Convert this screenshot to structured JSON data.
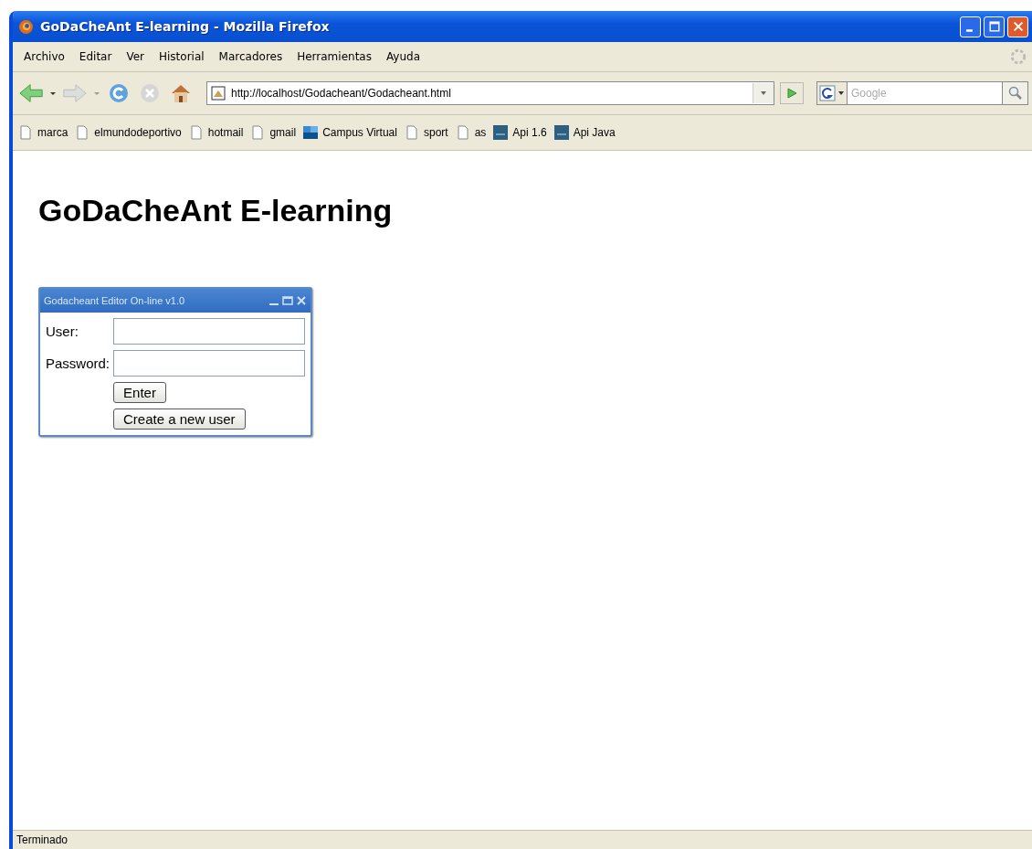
{
  "window": {
    "title": "GoDaCheAnt E-learning - Mozilla Firefox"
  },
  "menu": [
    "Archivo",
    "Editar",
    "Ver",
    "Historial",
    "Marcadores",
    "Herramientas",
    "Ayuda"
  ],
  "address": {
    "value": "http://localhost/Godacheant/Godacheant.html"
  },
  "search": {
    "placeholder": "Google"
  },
  "bookmarks": [
    {
      "label": "marca",
      "kind": "page"
    },
    {
      "label": "elmundodeportivo",
      "kind": "page"
    },
    {
      "label": "hotmail",
      "kind": "page"
    },
    {
      "label": "gmail",
      "kind": "page"
    },
    {
      "label": "Campus Virtual",
      "kind": "campus"
    },
    {
      "label": "sport",
      "kind": "page"
    },
    {
      "label": "as",
      "kind": "page"
    },
    {
      "label": "Api 1.6",
      "kind": "sun"
    },
    {
      "label": "Api Java",
      "kind": "sun"
    }
  ],
  "page": {
    "heading": "GoDaCheAnt E-learning",
    "dialog": {
      "title": "Godacheant Editor On-line v1.0",
      "fields": [
        {
          "label": "User:"
        },
        {
          "label": "Password:"
        }
      ],
      "buttons": [
        "Enter",
        "Create a new user"
      ]
    }
  },
  "status_bar": {
    "text": "Terminado"
  }
}
